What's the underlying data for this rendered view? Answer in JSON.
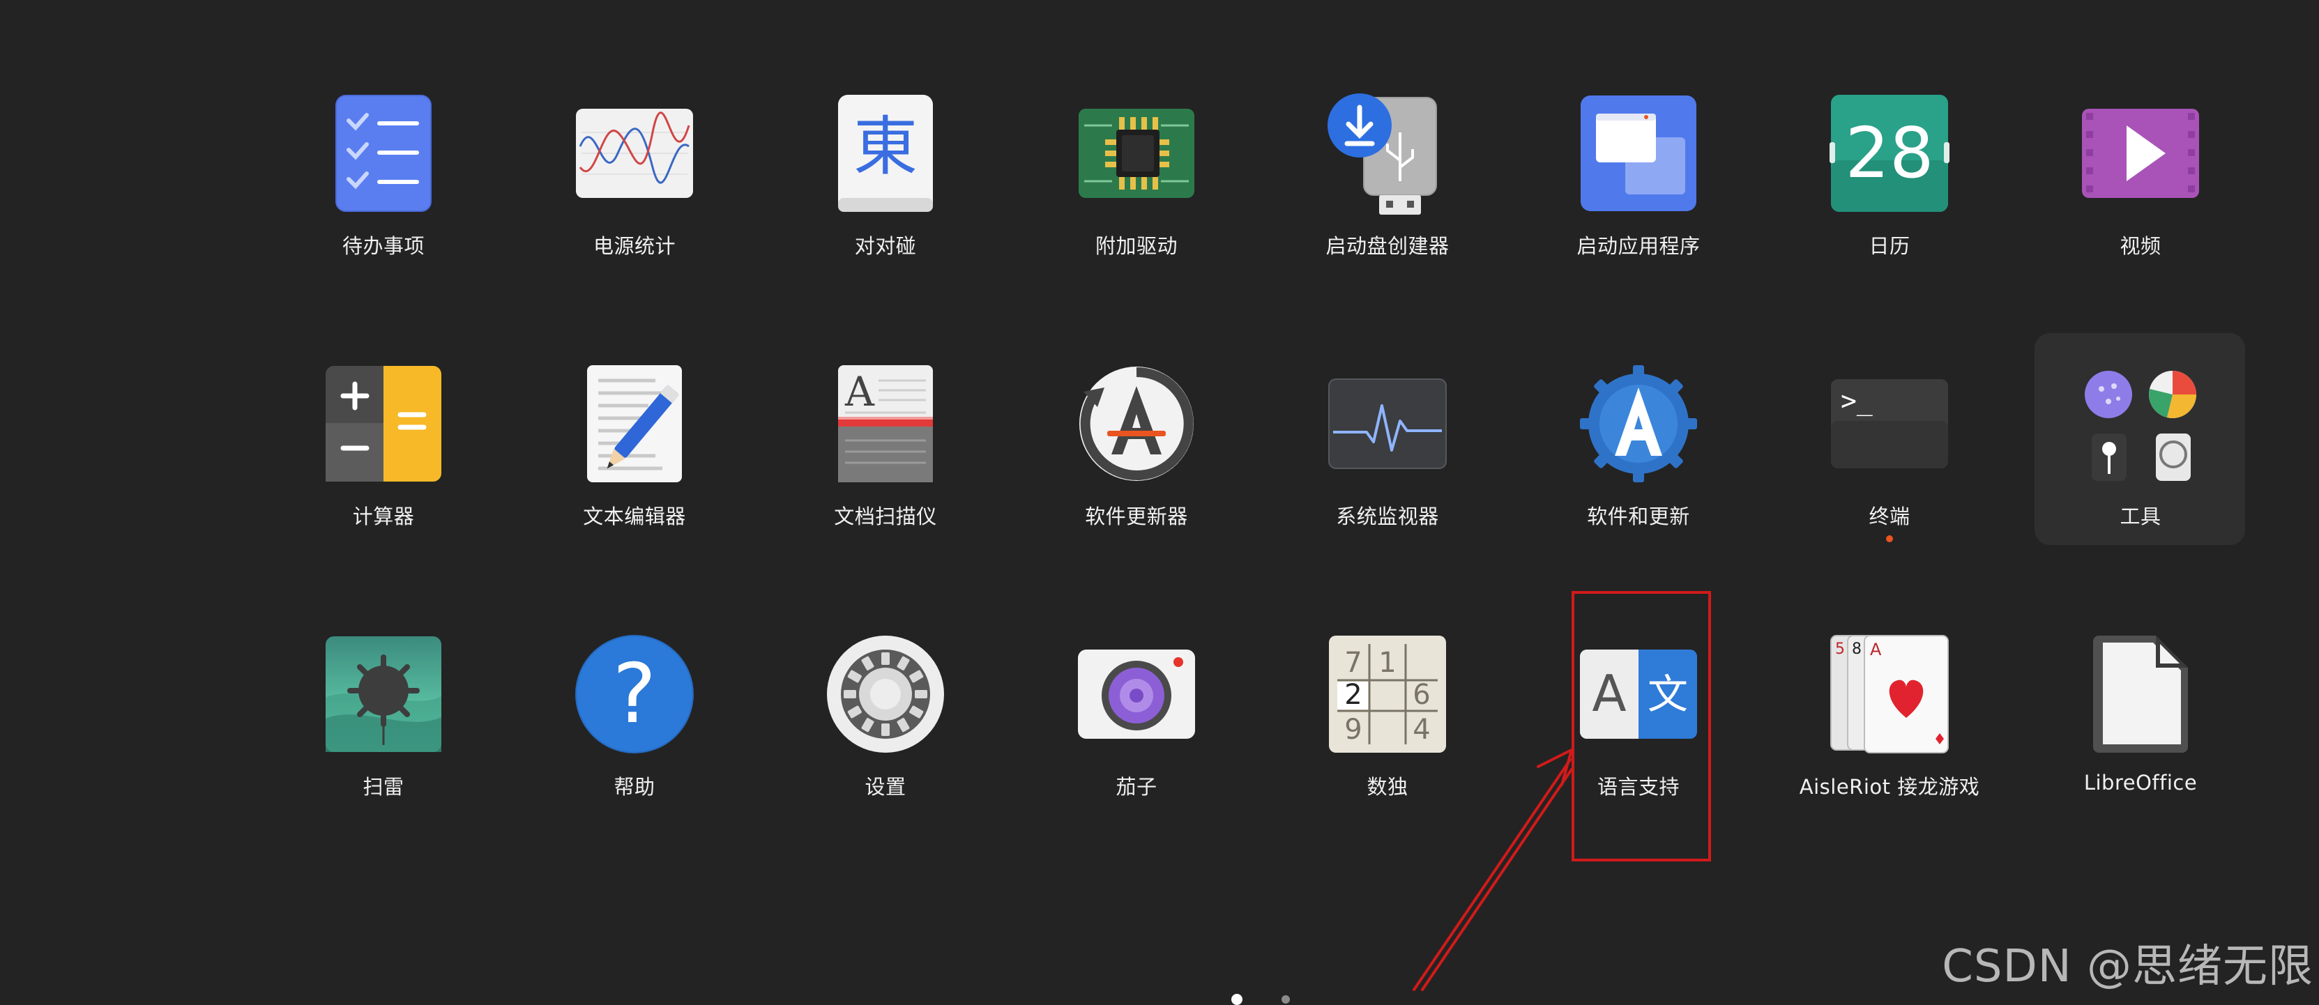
{
  "apps": {
    "row1": [
      {
        "label": "待办事项",
        "icon": "todo-icon"
      },
      {
        "label": "电源统计",
        "icon": "power-statistics-icon"
      },
      {
        "label": "对对碰",
        "icon": "mahjongg-icon"
      },
      {
        "label": "附加驱动",
        "icon": "additional-drivers-icon"
      },
      {
        "label": "启动盘创建器",
        "icon": "startup-disk-creator-icon"
      },
      {
        "label": "启动应用程序",
        "icon": "startup-applications-icon"
      },
      {
        "label": "日历",
        "icon": "calendar-icon",
        "date": "28"
      },
      {
        "label": "视频",
        "icon": "videos-icon"
      }
    ],
    "row2": [
      {
        "label": "计算器",
        "icon": "calculator-icon"
      },
      {
        "label": "文本编辑器",
        "icon": "text-editor-icon"
      },
      {
        "label": "文档扫描仪",
        "icon": "document-scanner-icon"
      },
      {
        "label": "软件更新器",
        "icon": "software-updater-icon"
      },
      {
        "label": "系统监视器",
        "icon": "system-monitor-icon"
      },
      {
        "label": "软件和更新",
        "icon": "software-and-updates-icon"
      },
      {
        "label": "终端",
        "icon": "terminal-icon",
        "prompt": ">_"
      },
      {
        "label": "工具",
        "icon": "utilities-folder-icon"
      }
    ],
    "row3": [
      {
        "label": "扫雷",
        "icon": "mines-icon"
      },
      {
        "label": "帮助",
        "icon": "help-icon",
        "glyph": "?"
      },
      {
        "label": "设置",
        "icon": "settings-icon"
      },
      {
        "label": "茄子",
        "icon": "cheese-icon"
      },
      {
        "label": "数独",
        "icon": "sudoku-icon",
        "cells": [
          "7",
          "1",
          "",
          "2",
          "",
          "6",
          "9",
          "",
          "4"
        ]
      },
      {
        "label": "语言支持",
        "icon": "language-support-icon",
        "left": "A",
        "right": "文"
      },
      {
        "label": "AisleRiot 接龙游戏",
        "icon": "aisleriot-icon",
        "cards": [
          "5",
          "8",
          "A"
        ]
      },
      {
        "label": "LibreOffice",
        "icon": "libreoffice-icon"
      }
    ]
  },
  "colors": {
    "background": "#232323",
    "annotation": "#d11a1a",
    "running_indicator": "#e95420"
  },
  "pagination": {
    "pages": 2,
    "current": 1
  },
  "watermark": "CSDN @思绪无限"
}
